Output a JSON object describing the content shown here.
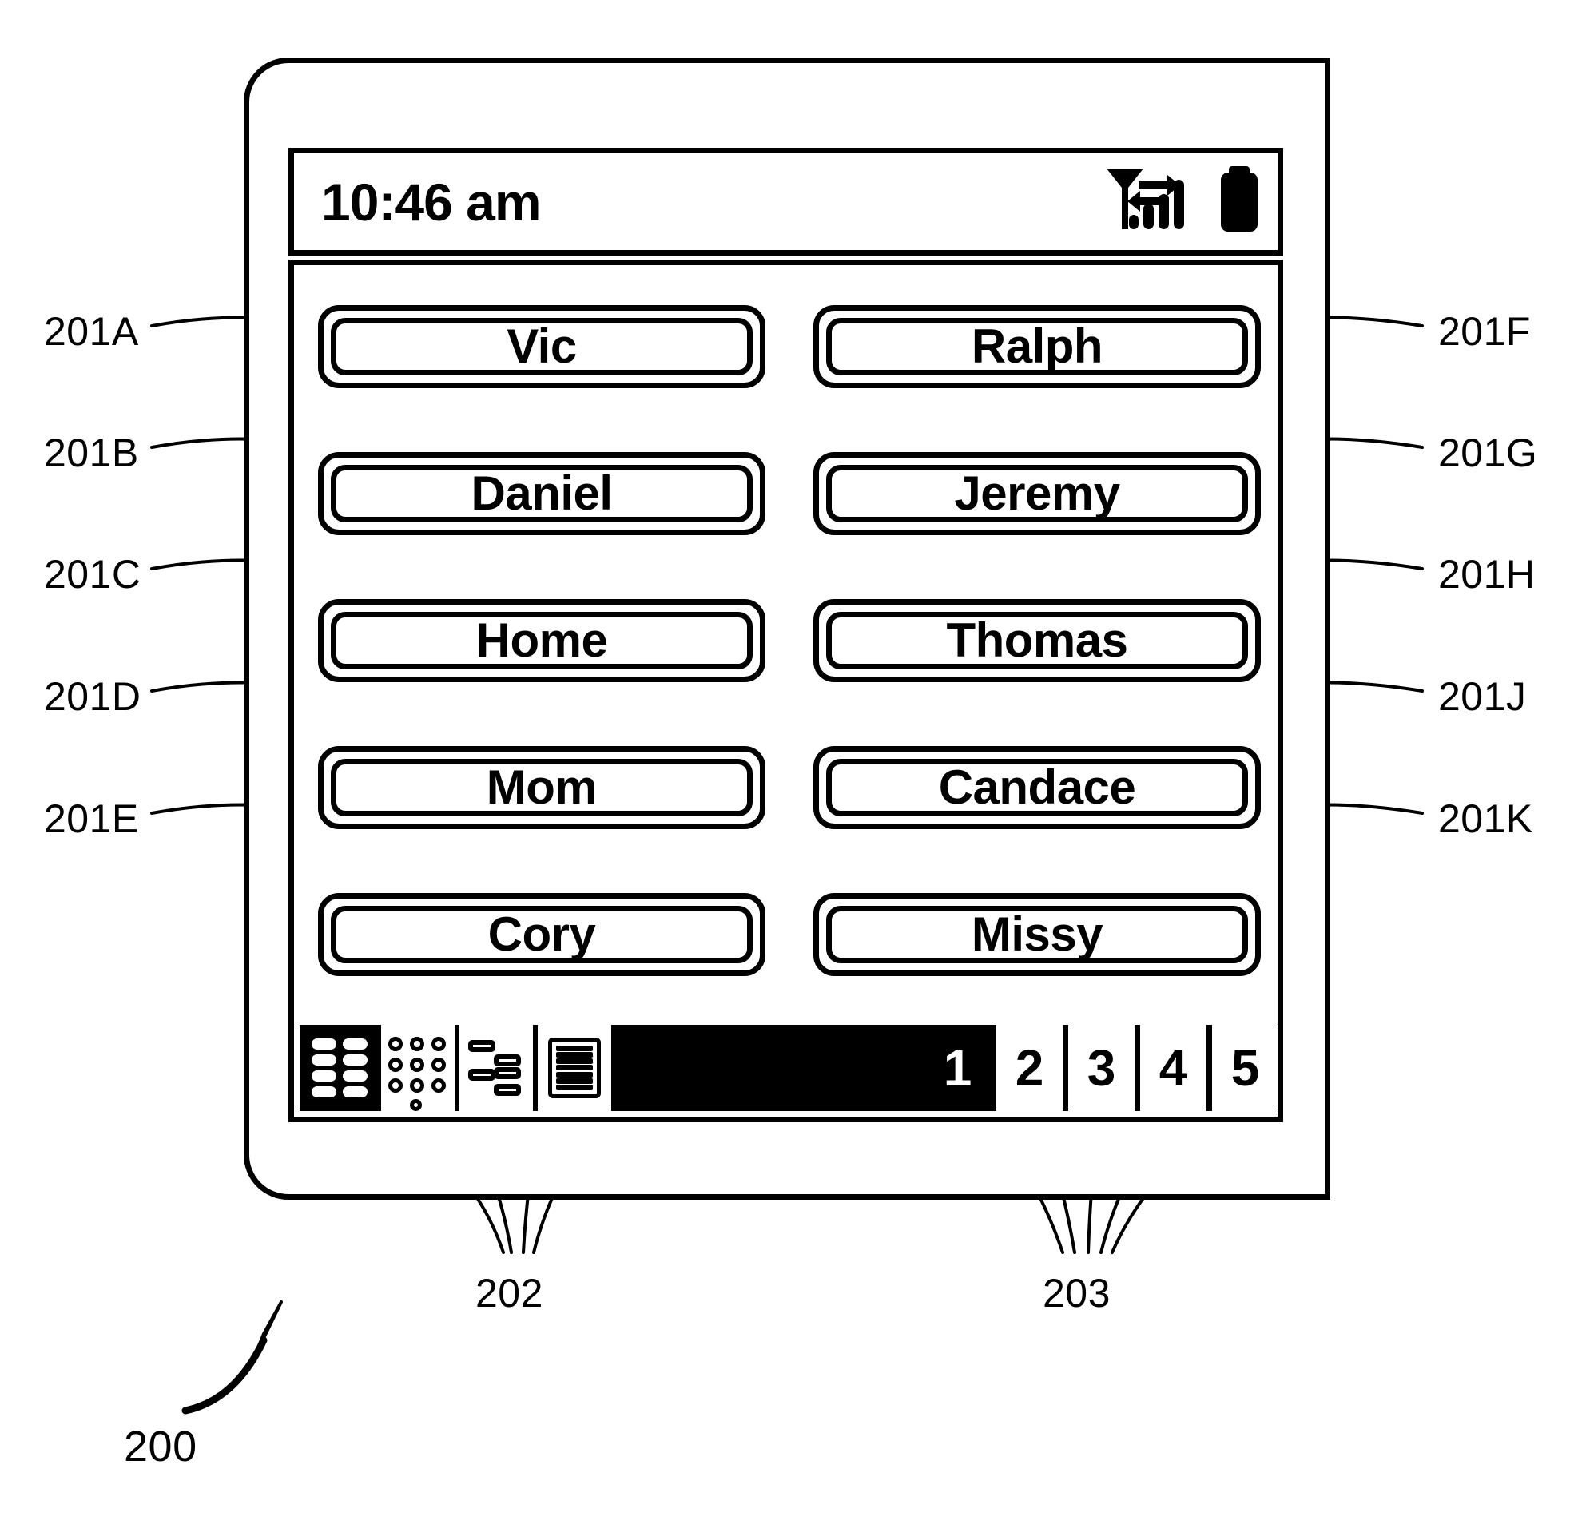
{
  "figure": {
    "number": "200",
    "device_ref": "200",
    "toolbar_ref": "202",
    "page_tabs_ref": "203"
  },
  "status_bar": {
    "time": "10:46 am",
    "icons": [
      {
        "name": "signal-strength-icon",
        "label": "signal"
      },
      {
        "name": "data-transfer-icon",
        "label": "data"
      },
      {
        "name": "battery-icon",
        "label": "battery"
      }
    ]
  },
  "speed_dial": {
    "buttons": [
      {
        "ref": "201A",
        "label": "Vic",
        "column": "left",
        "row": 1
      },
      {
        "ref": "201B",
        "label": "Daniel",
        "column": "left",
        "row": 2
      },
      {
        "ref": "201C",
        "label": "Home",
        "column": "left",
        "row": 3
      },
      {
        "ref": "201D",
        "label": "Mom",
        "column": "left",
        "row": 4
      },
      {
        "ref": "201E",
        "label": "Cory",
        "column": "left",
        "row": 5
      },
      {
        "ref": "201F",
        "label": "Ralph",
        "column": "right",
        "row": 1
      },
      {
        "ref": "201G",
        "label": "Jeremy",
        "column": "right",
        "row": 2
      },
      {
        "ref": "201H",
        "label": "Thomas",
        "column": "right",
        "row": 3
      },
      {
        "ref": "201J",
        "label": "Candace",
        "column": "right",
        "row": 4
      },
      {
        "ref": "201K",
        "label": "Missy",
        "column": "right",
        "row": 5
      }
    ]
  },
  "toolbar": {
    "ref": "202",
    "items": [
      {
        "name": "speed-dial-grid-icon",
        "label": "Speed Dial",
        "selected": true
      },
      {
        "name": "keypad-icon",
        "label": "Keypad",
        "selected": false
      },
      {
        "name": "call-log-icon",
        "label": "Call Log",
        "selected": false
      },
      {
        "name": "contact-list-icon",
        "label": "Contacts",
        "selected": false
      }
    ]
  },
  "page_tabs": {
    "ref": "203",
    "active": "1",
    "tabs": [
      "1",
      "2",
      "3",
      "4",
      "5"
    ]
  },
  "reference_labels": {
    "left": [
      "201A",
      "201B",
      "201C",
      "201D",
      "201E"
    ],
    "right": [
      "201F",
      "201G",
      "201H",
      "201J",
      "201K"
    ],
    "bottom": [
      "202",
      "203"
    ],
    "figure": "200"
  },
  "colors": {
    "ink": "#000000",
    "paper": "#ffffff"
  }
}
